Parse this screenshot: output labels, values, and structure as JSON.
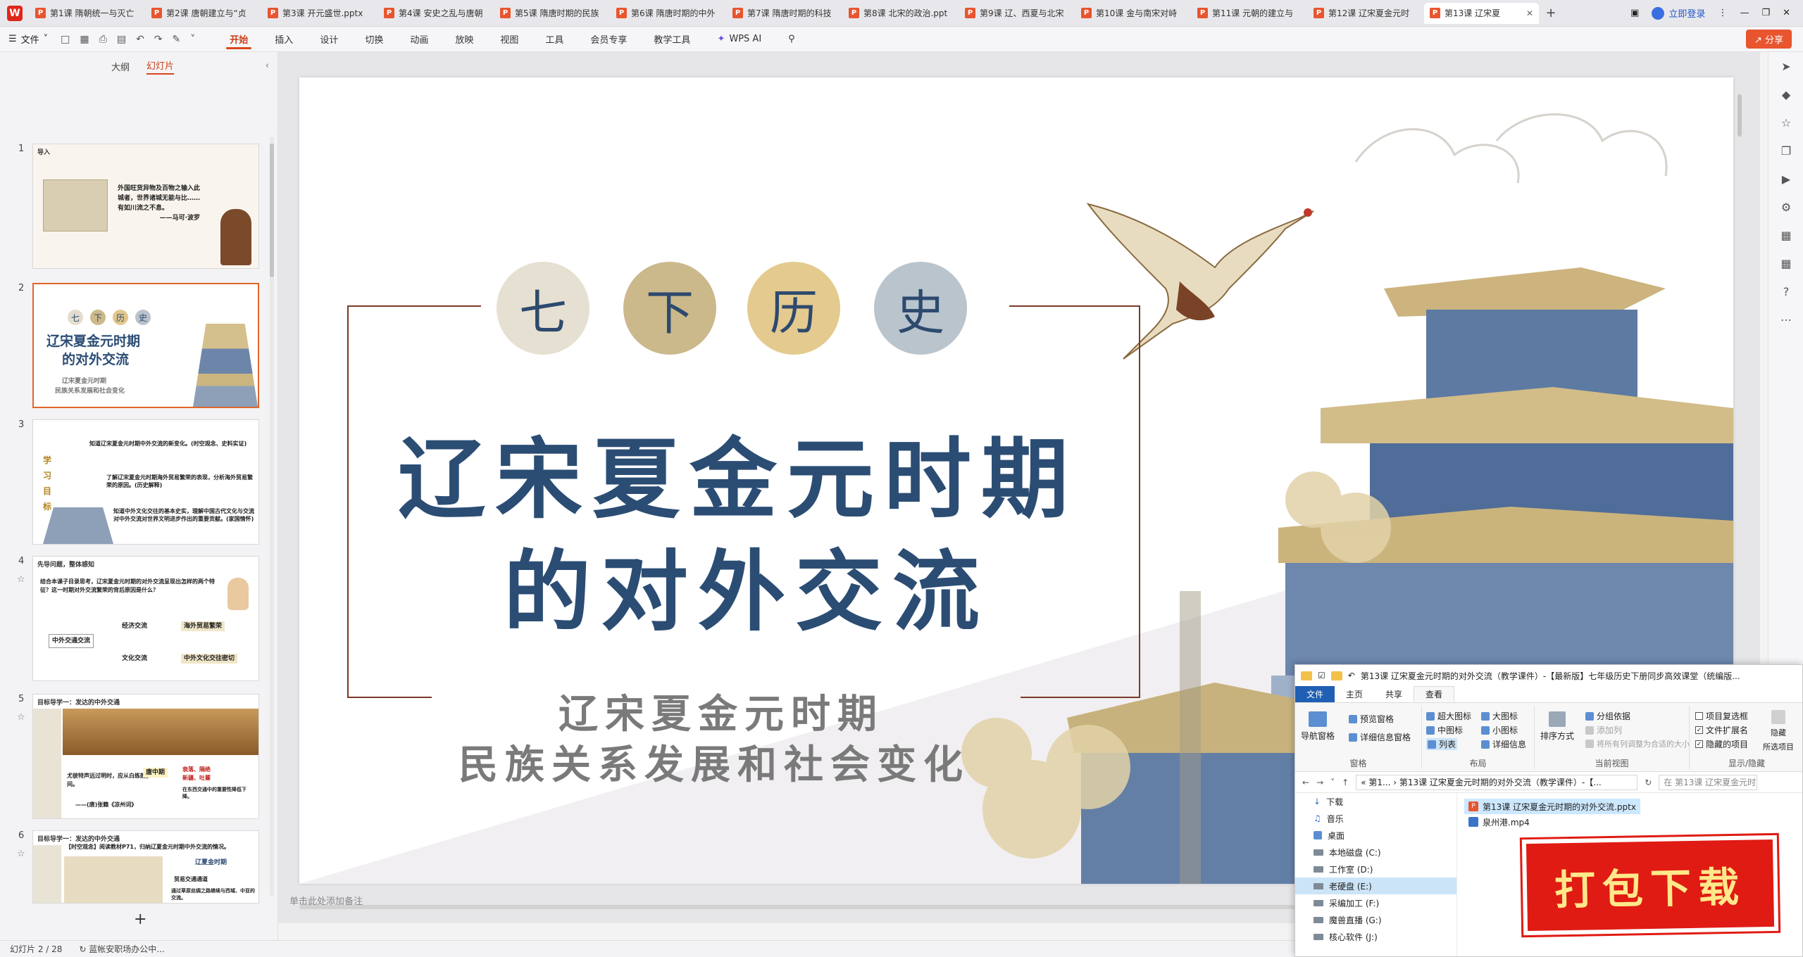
{
  "tabs": [
    {
      "label": "第1课 隋朝统一与灭亡",
      "active": false
    },
    {
      "label": "第2课 唐朝建立与“贞",
      "active": false
    },
    {
      "label": "第3课 开元盛世.pptx",
      "active": false
    },
    {
      "label": "第4课 安史之乱与唐朝",
      "active": false
    },
    {
      "label": "第5课 隋唐时期的民族",
      "active": false
    },
    {
      "label": "第6课 隋唐时期的中外",
      "active": false
    },
    {
      "label": "第7课 隋唐时期的科技",
      "active": false
    },
    {
      "label": "第8课 北宋的政治.ppt",
      "active": false
    },
    {
      "label": "第9课 辽、西夏与北宋",
      "active": false
    },
    {
      "label": "第10课 金与南宋对峙",
      "active": false
    },
    {
      "label": "第11课 元朝的建立与",
      "active": false
    },
    {
      "label": "第12课 辽宋夏金元时",
      "active": false
    },
    {
      "label": "第13课 辽宋夏",
      "active": true
    }
  ],
  "titlebar": {
    "login": "立即登录",
    "new_tab": "+"
  },
  "menu": {
    "file": "文件",
    "tabs": [
      "开始",
      "插入",
      "设计",
      "切换",
      "动画",
      "放映",
      "视图",
      "工具",
      "会员专享",
      "教学工具"
    ],
    "active_tab": "开始",
    "wps_ai": "WPS AI",
    "share": "分享"
  },
  "left_panel": {
    "tabs": [
      "大纲",
      "幻灯片"
    ],
    "active_tab": "幻灯片",
    "selected_slide": 2,
    "thumbs": [
      {
        "num": "1",
        "head": "导入",
        "lines": [
          "外国旺货异物及百物之输入此",
          "城者，世界诸城无能与比……",
          "有如川流之不息。",
          "——马可·波罗"
        ]
      },
      {
        "num": "2",
        "head": "",
        "lines": [
          "七",
          "下",
          "历",
          "史",
          "辽宋夏金元时期",
          "的对外交流",
          "辽宋夏金元时期",
          "民族关系发展和社会变化"
        ]
      },
      {
        "num": "3",
        "head": "",
        "lines": [
          "学习目标",
          "知道辽宋夏金元时期中外交流的新变化。(时空观念、史料实证)",
          "了解辽宋夏金元时期海外贸易繁荣的表现，分析海外贸易繁荣的原因。(历史解释)",
          "知道中外文化交往的基本史实，理解中国古代文化与交流对中外交流对世界文明进步作出的重要贡献。(家国情怀)"
        ]
      },
      {
        "num": "4",
        "head": "先导问题，整体感知",
        "lines": [
          "结合本课子目录思考，辽宋夏金元时期的对外交流呈现出怎样的两个特征？这一时期对外交流繁荣的背后原因是什么？",
          "中外交通交流",
          "经济交流",
          "海外贸易繁荣",
          "文化交流",
          "中外文化交往密切"
        ]
      },
      {
        "num": "5",
        "head": "目标导学一：发达的中外交通",
        "lines": [
          "尤彼特声远过明时，应从白练朗岁间。",
          "——(唐)张籍《凉州词》",
          "唐中期",
          "衰落、隔绝",
          "新疆、吐蕃",
          "在东西交通中的重要性降低下降。"
        ]
      },
      {
        "num": "6",
        "head": "目标导学一：发达的中外交通",
        "lines": [
          "【时空观念】阅读教材P71，归纳辽夏金元时期中外交流的情况。",
          "辽夏金时期",
          "贸易交通通道",
          "通过草原丝绸之路继续与西域、中亚的交流。"
        ]
      }
    ]
  },
  "slide": {
    "chars": [
      "七",
      "下",
      "历",
      "史"
    ],
    "title_line1": "辽宋夏金元时期",
    "title_line2": "的对外交流",
    "subtitle_line1": "辽宋夏金元时期",
    "subtitle_line2": "民族关系发展和社会变化",
    "notes_placeholder": "单击此处添加备注"
  },
  "status": {
    "slide_counter": "幻灯片 2 / 28",
    "status_text": "蓝帐安职场办公中..."
  },
  "explorer": {
    "title": "第13课 辽宋夏金元时期的对外交流（教学课件）-【最新版】七年级历史下册同步高效课堂（统编版...",
    "ribbon_tabs": [
      "文件",
      "主页",
      "共享",
      "查看"
    ],
    "active_ribbon_tab": "查看",
    "panes_group": {
      "name": "窗格",
      "nav_pane": "导航窗格",
      "preview": "预览窗格",
      "details": "详细信息窗格"
    },
    "layout_group": {
      "name": "布局",
      "items": [
        "超大图标",
        "大图标",
        "中图标",
        "小图标",
        "列表",
        "详细信息"
      ],
      "selected": "列表"
    },
    "view_group": {
      "name": "当前视图",
      "sort": "排序方式",
      "group_by": "分组依据",
      "add_col": "添加列",
      "fit": "将所有列调整为合适的大小"
    },
    "show_group": {
      "name": "显示/隐藏",
      "checkboxes": "项目复选框",
      "extensions": "文件扩展名",
      "hidden": "隐藏的项目",
      "hide_selected": "隐藏",
      "hide_selected2": "所选项目"
    },
    "address": "« 第1... › 第13课 辽宋夏金元时期的对外交流（教学课件）-【...",
    "search_placeholder": "在 第13课 辽宋夏金元时",
    "nav_items": [
      "下载",
      "音乐",
      "桌面",
      "本地磁盘 (C:)",
      "工作室 (D:)",
      "老硬盘 (E:)",
      "采编加工 (F:)",
      "魔兽直播 (G:)",
      "核心软件 (J:)"
    ],
    "nav_selected": "老硬盘 (E:)",
    "files": [
      "第13课 辽宋夏金元时期的对外交流.pptx",
      "泉州港.mp4"
    ]
  },
  "stamp": {
    "text": "打包下载"
  },
  "colors": {
    "accent": "#d9461d",
    "title_blue": "#2b4d74",
    "stamp_red": "#e01b13"
  }
}
